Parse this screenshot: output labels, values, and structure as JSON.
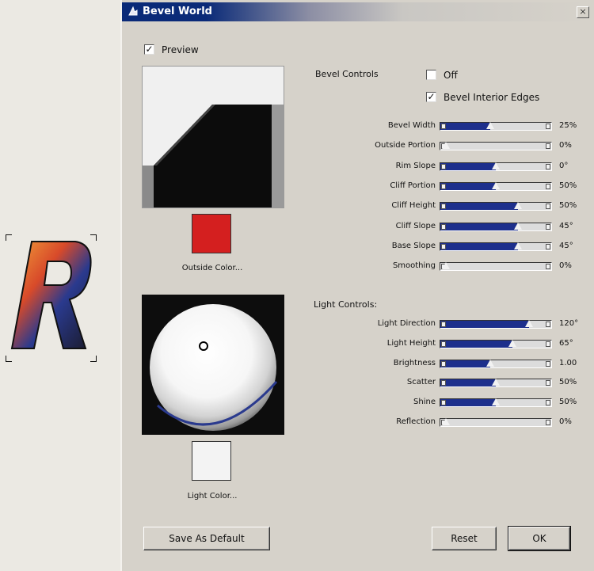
{
  "window": {
    "title": "Bevel World",
    "close_glyph": "×"
  },
  "preview": {
    "label": "Preview",
    "checked": true
  },
  "outside_color": {
    "label": "Outside Color...",
    "color": "#d41f1f"
  },
  "light_color": {
    "label": "Light Color...",
    "color": "#f3f3f3"
  },
  "bevel_controls": {
    "heading": "Bevel Controls",
    "off": {
      "label": "Off",
      "checked": false
    },
    "bevel_interior_edges": {
      "label": "Bevel Interior Edges",
      "checked": true
    },
    "sliders": [
      {
        "label": "Bevel Width",
        "value": "25%",
        "fill": 0.45
      },
      {
        "label": "Outside Portion",
        "value": "0%",
        "fill": 0.0
      },
      {
        "label": "Rim Slope",
        "value": "0°",
        "fill": 0.5
      },
      {
        "label": "Cliff Portion",
        "value": "50%",
        "fill": 0.5
      },
      {
        "label": "Cliff Height",
        "value": "50%",
        "fill": 0.7
      },
      {
        "label": "Cliff Slope",
        "value": "45°",
        "fill": 0.7
      },
      {
        "label": "Base Slope",
        "value": "45°",
        "fill": 0.7
      },
      {
        "label": "Smoothing",
        "value": "0%",
        "fill": 0.0
      }
    ]
  },
  "light_controls": {
    "heading": "Light Controls:",
    "sliders": [
      {
        "label": "Light Direction",
        "value": "120°",
        "fill": 0.8
      },
      {
        "label": "Light Height",
        "value": "65°",
        "fill": 0.65
      },
      {
        "label": "Brightness",
        "value": "1.00",
        "fill": 0.45
      },
      {
        "label": "Scatter",
        "value": "50%",
        "fill": 0.5
      },
      {
        "label": "Shine",
        "value": "50%",
        "fill": 0.5
      },
      {
        "label": "Reflection",
        "value": "0%",
        "fill": 0.0
      }
    ]
  },
  "buttons": {
    "save_default": "Save As Default",
    "reset": "Reset",
    "ok": "OK"
  },
  "colors": {
    "title_bar": "#0a2a78",
    "slider_fill": "#1d2f8c"
  },
  "icons": {
    "title": "bevel-world-icon",
    "close": "close-icon"
  }
}
